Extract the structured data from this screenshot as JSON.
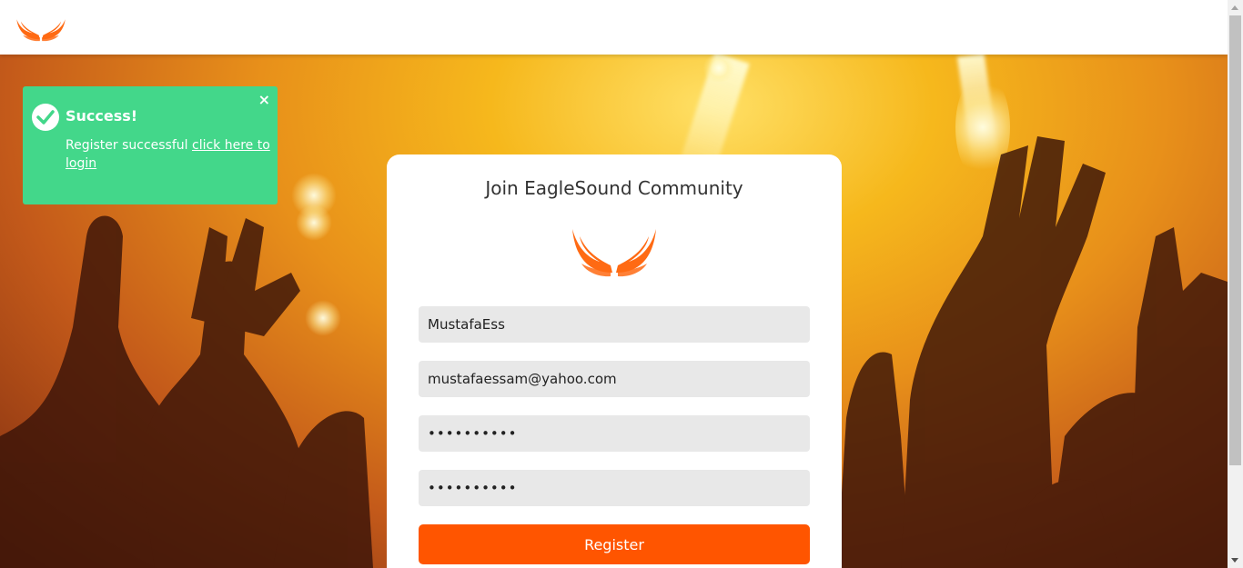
{
  "header": {
    "logo_icon": "eagle-wings-logo-icon"
  },
  "toast": {
    "title": "Success!",
    "message": "Register successful",
    "link_text": "click here to login",
    "close_icon": "×",
    "color": "#43d78a"
  },
  "form": {
    "title": "Join EagleSound Community",
    "logo_icon": "eagle-wings-logo-icon",
    "username_value": "MustafaEss",
    "email_value": "mustafaessam@yahoo.com",
    "password_value": "••••••••••",
    "confirm_password_value": "••••••••••",
    "register_label": "Register",
    "accent_color": "#ff5500"
  }
}
